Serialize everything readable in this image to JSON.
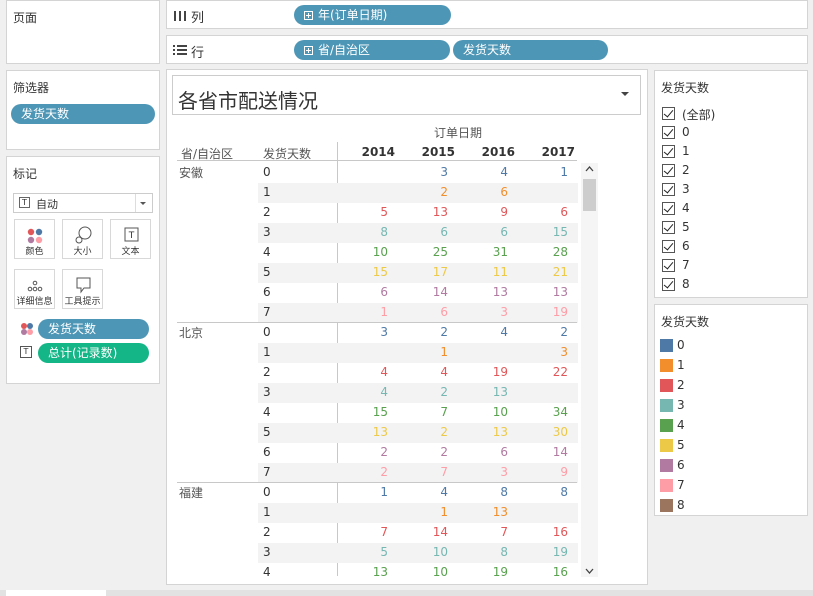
{
  "pages_title": "页面",
  "filters": {
    "title": "筛选器",
    "pill": "发货天数"
  },
  "marks": {
    "title": "标记",
    "type_value": "自动",
    "cards": [
      "颜色",
      "大小",
      "文本",
      "详细信息",
      "工具提示"
    ],
    "pill_color": "发货天数",
    "pill_text": "总计(记录数)"
  },
  "columns_shelf": {
    "label": "列",
    "pills": [
      "年(订单日期)"
    ]
  },
  "rows_shelf": {
    "label": "行",
    "pills": [
      "省/自治区",
      "发货天数"
    ]
  },
  "view": {
    "title": "各省市配送情况",
    "column_group_header": "订单日期",
    "row_headers": [
      "省/自治区",
      "发货天数"
    ],
    "years": [
      "2014",
      "2015",
      "2016",
      "2017"
    ],
    "provinces": [
      {
        "name": "安徽",
        "rows": [
          {
            "d": "0",
            "v": [
              "",
              "3",
              "4",
              "1"
            ]
          },
          {
            "d": "1",
            "v": [
              "",
              "2",
              "6",
              ""
            ]
          },
          {
            "d": "2",
            "v": [
              "5",
              "13",
              "9",
              "6"
            ]
          },
          {
            "d": "3",
            "v": [
              "8",
              "6",
              "6",
              "15"
            ]
          },
          {
            "d": "4",
            "v": [
              "10",
              "25",
              "31",
              "28"
            ]
          },
          {
            "d": "5",
            "v": [
              "15",
              "17",
              "11",
              "21"
            ]
          },
          {
            "d": "6",
            "v": [
              "6",
              "14",
              "13",
              "13"
            ]
          },
          {
            "d": "7",
            "v": [
              "1",
              "6",
              "3",
              "19"
            ]
          }
        ]
      },
      {
        "name": "北京",
        "rows": [
          {
            "d": "0",
            "v": [
              "3",
              "2",
              "4",
              "2"
            ]
          },
          {
            "d": "1",
            "v": [
              "",
              "1",
              "",
              "3"
            ]
          },
          {
            "d": "2",
            "v": [
              "4",
              "4",
              "19",
              "22"
            ]
          },
          {
            "d": "3",
            "v": [
              "4",
              "2",
              "13",
              ""
            ]
          },
          {
            "d": "4",
            "v": [
              "15",
              "7",
              "10",
              "34"
            ]
          },
          {
            "d": "5",
            "v": [
              "13",
              "2",
              "13",
              "30"
            ]
          },
          {
            "d": "6",
            "v": [
              "2",
              "2",
              "6",
              "14"
            ]
          },
          {
            "d": "7",
            "v": [
              "2",
              "7",
              "3",
              "9"
            ]
          }
        ]
      },
      {
        "name": "福建",
        "rows": [
          {
            "d": "0",
            "v": [
              "1",
              "4",
              "8",
              "8"
            ]
          },
          {
            "d": "1",
            "v": [
              "",
              "1",
              "13",
              ""
            ]
          },
          {
            "d": "2",
            "v": [
              "7",
              "14",
              "7",
              "16"
            ]
          },
          {
            "d": "3",
            "v": [
              "5",
              "10",
              "8",
              "19"
            ]
          },
          {
            "d": "4",
            "v": [
              "13",
              "10",
              "19",
              "16"
            ]
          }
        ]
      }
    ]
  },
  "filter_card": {
    "title": "发货天数",
    "items": [
      "(全部)",
      "0",
      "1",
      "2",
      "3",
      "4",
      "5",
      "6",
      "7",
      "8"
    ]
  },
  "legend": {
    "title": "发货天数",
    "items": [
      {
        "label": "0",
        "color": "#4e79a7"
      },
      {
        "label": "1",
        "color": "#f28e2b"
      },
      {
        "label": "2",
        "color": "#e15759"
      },
      {
        "label": "3",
        "color": "#76b7b2"
      },
      {
        "label": "4",
        "color": "#59a14f"
      },
      {
        "label": "5",
        "color": "#edc948"
      },
      {
        "label": "6",
        "color": "#b07aa1"
      },
      {
        "label": "7",
        "color": "#ff9da7"
      },
      {
        "label": "8",
        "color": "#9c755f"
      }
    ]
  },
  "value_colors": {
    "0": "#4e79a7",
    "1": "#f28e2b",
    "2": "#e15759",
    "3": "#76b7b2",
    "4": "#59a14f",
    "5": "#edc948",
    "6": "#b07aa1",
    "7": "#ff9da7",
    "8": "#9c755f"
  }
}
